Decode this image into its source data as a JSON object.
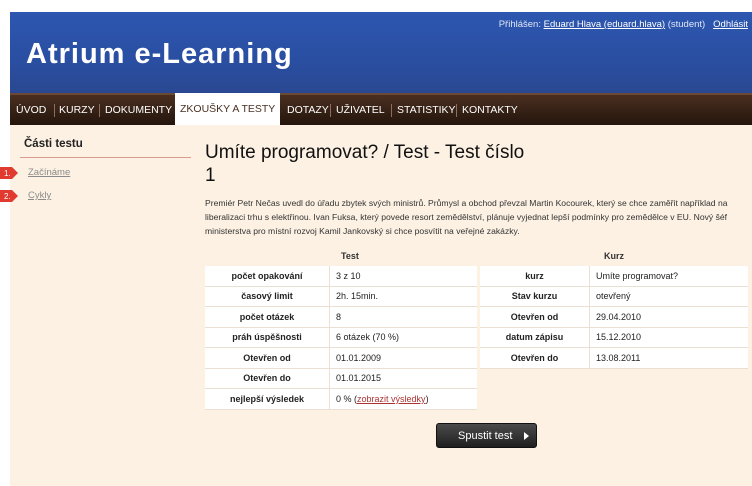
{
  "header": {
    "site_title": "Atrium e-Learning",
    "login_prefix": "Přihlášen:",
    "user": "Eduard Hlava (eduard.hlava)",
    "role": "(student)",
    "logout": "Odhlásit"
  },
  "nav": {
    "items": [
      {
        "label": "ÚVOD"
      },
      {
        "label": "KURZY"
      },
      {
        "label": "DOKUMENTY"
      },
      {
        "label": "ZKOUŠKY A TESTY"
      },
      {
        "label": "DOTAZY"
      },
      {
        "label": "UŽIVATEL"
      },
      {
        "label": "STATISTIKY"
      },
      {
        "label": "KONTAKTY"
      }
    ],
    "active": "ZKOUŠKY A TESTY"
  },
  "sidebar": {
    "heading": "Části testu",
    "items": [
      {
        "num": "1.",
        "label": "Začínáme"
      },
      {
        "num": "2.",
        "label": "Cykly"
      }
    ]
  },
  "main": {
    "title": "Umíte programovat? / Test - Test číslo 1",
    "intro": "Premiér Petr Nečas uvedl do úřadu zbytek svých ministrů. Průmysl a obchod převzal Martin Kocourek, který se chce zaměřit například na liberalizaci trhu s elektřinou. Ivan Fuksa, který povede resort zemědělství, plánuje vyjednat lepší podmínky pro zemědělce v EU. Nový šéf ministerstva pro místní rozvoj Kamil Jankovský si chce posvítit na veřejné zakázky.",
    "test_table": {
      "heading": "Test",
      "rows": [
        {
          "key": "počet opakování",
          "value": "3 z 10"
        },
        {
          "key": "časový limit",
          "value": "2h. 15min."
        },
        {
          "key": "počet otázek",
          "value": "8"
        },
        {
          "key": "práh úspěšnosti",
          "value": "6 otázek (70 %)"
        },
        {
          "key": "Otevřen od",
          "value": "01.01.2009"
        },
        {
          "key": "Otevřen do",
          "value": "01.01.2015"
        },
        {
          "key": "nejlepší výsledek",
          "value": "0 %",
          "link_open": "(",
          "link": "zobrazit výsledky",
          "link_close": ")"
        }
      ]
    },
    "course_table": {
      "heading": "Kurz",
      "rows": [
        {
          "key": "kurz",
          "value": "Umíte programovat?"
        },
        {
          "key": "Stav kurzu",
          "value": "otevřený"
        },
        {
          "key": "Otevřen od",
          "value": "29.04.2010"
        },
        {
          "key": "datum zápisu",
          "value": "15.12.2010"
        },
        {
          "key": "Otevřen do",
          "value": "13.08.2011"
        }
      ]
    },
    "start_button": "Spustit test"
  },
  "colors": {
    "header_blue": "#2a4fa3",
    "nav_brown": "#3a2416",
    "content_bg": "#fcf1e3",
    "accent_red": "#e03b2e"
  }
}
